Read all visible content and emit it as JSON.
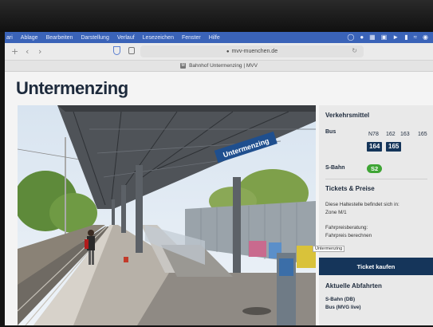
{
  "menubar": {
    "items": [
      "ari",
      "Ablage",
      "Bearbeiten",
      "Darstellung",
      "Verlauf",
      "Lesezeichen",
      "Fenster",
      "Hilfe"
    ]
  },
  "toolbar": {
    "url": "mvv-muenchen.de"
  },
  "tab": {
    "title": "Bahnhof Untermenzing | MVV"
  },
  "page": {
    "title": "Untermenzing",
    "station_sign": "Untermenzing"
  },
  "sidebar": {
    "transport_heading": "Verkehrsmittel",
    "bus_label": "Bus",
    "bus_lines_top": [
      "N78",
      "162",
      "163",
      "165"
    ],
    "bus_lines_badges": [
      "164",
      "165"
    ],
    "sbahn_label": "S-Bahn",
    "sbahn_line": "S2",
    "tickets_heading": "Tickets & Preise",
    "zone_text_1": "Diese Haltestelle befindet sich in:",
    "zone_text_2": "Zone M/1",
    "advice_1": "Fahrpreisberatung:",
    "advice_2": "Fahrpreis berechnen",
    "buy_button": "Ticket kaufen",
    "departures_heading": "Aktuelle Abfahrten",
    "dep_1": "S-Bahn (DB)",
    "dep_2": "Bus (MVG live)"
  },
  "tooltip": "Untermenzing",
  "colors": {
    "mvv_blue": "#15355a",
    "sbahn_green": "#3fa535",
    "menubar_blue": "#3a63b8"
  }
}
